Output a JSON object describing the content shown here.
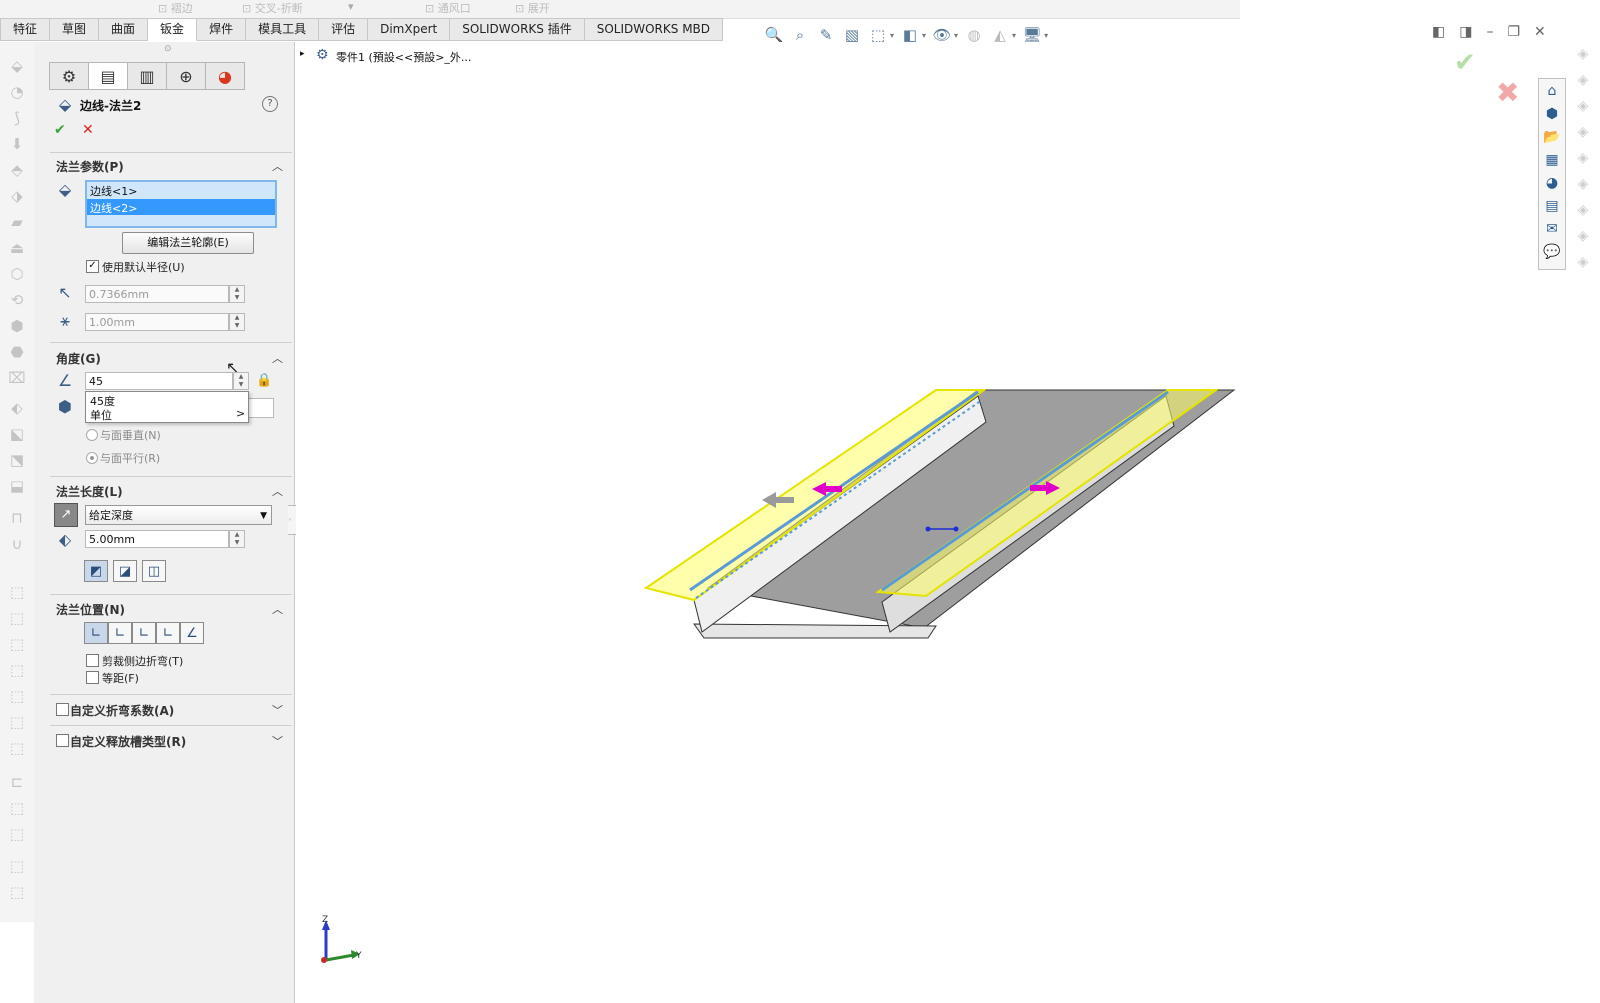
{
  "ribbon_ghost": [
    "褶边",
    "交叉-折断",
    "通风口",
    "展开"
  ],
  "tabs": [
    {
      "label": "特征",
      "active": false
    },
    {
      "label": "草图",
      "active": false
    },
    {
      "label": "曲面",
      "active": false
    },
    {
      "label": "钣金",
      "active": true
    },
    {
      "label": "焊件",
      "active": false
    },
    {
      "label": "模具工具",
      "active": false
    },
    {
      "label": "评估",
      "active": false
    },
    {
      "label": "DimXpert",
      "active": false
    },
    {
      "label": "SOLIDWORKS 插件",
      "active": false
    },
    {
      "label": "SOLIDWORKS MBD",
      "active": false
    }
  ],
  "tree": {
    "arrow": "▸",
    "label": "零件1 (預設<<預設>_外..."
  },
  "feature": {
    "title": "边线-法兰2",
    "help": "?",
    "ok": "✔",
    "cancel": "✕"
  },
  "flange_params": {
    "header": "法兰参数(P)",
    "edges": [
      "边线<1>",
      "边线<2>"
    ],
    "edit_profile_btn": "编辑法兰轮廓(E)",
    "use_default_radius_label": "使用默认半径(U)",
    "use_default_radius_checked": true,
    "radius_value": "0.7366mm",
    "gap_value": "1.00mm"
  },
  "angle": {
    "header": "角度(G)",
    "value": "45",
    "popup_items": [
      "45度",
      "单位"
    ],
    "popup_arrow": ">",
    "perp_label": "与面垂直(N)",
    "parallel_label": "与面平行(R)"
  },
  "flange_length": {
    "header": "法兰长度(L)",
    "end_condition": "给定深度",
    "depth_value": "5.00mm"
  },
  "flange_position": {
    "header": "法兰位置(N)",
    "trim_side_bends_label": "剪裁侧边折弯(T)",
    "offset_label": "等距(F)"
  },
  "custom_bend_allowance": {
    "label": "自定义折弯系数(A)"
  },
  "custom_relief": {
    "label": "自定义释放槽类型(R)"
  },
  "triad": {
    "z": "Z",
    "y": "Y"
  },
  "colors": {
    "selection_yellow": "#ffff33",
    "edge_blue": "#5b9bd5",
    "handle_magenta": "#e000c8",
    "accent": "#3399ff"
  }
}
